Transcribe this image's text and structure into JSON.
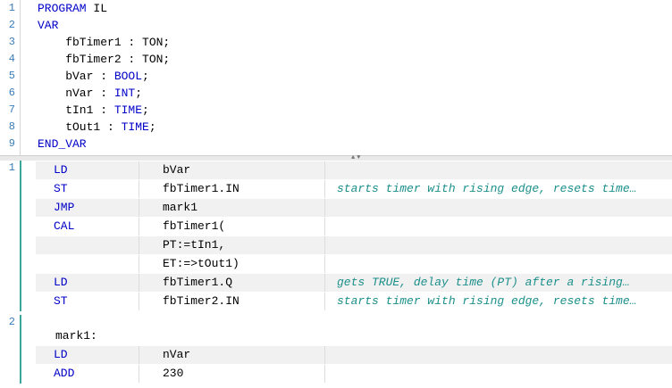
{
  "declaration": {
    "lines": [
      {
        "num": "1",
        "parts": [
          {
            "t": "PROGRAM",
            "k": "kw"
          },
          {
            "t": " IL",
            "k": ""
          }
        ]
      },
      {
        "num": "2",
        "parts": [
          {
            "t": "VAR",
            "k": "kw"
          }
        ]
      },
      {
        "num": "3",
        "parts": [
          {
            "t": "    fbTimer1 : TON;",
            "k": ""
          }
        ]
      },
      {
        "num": "4",
        "parts": [
          {
            "t": "    fbTimer2 : TON;",
            "k": ""
          }
        ]
      },
      {
        "num": "5",
        "parts": [
          {
            "t": "    bVar : ",
            "k": ""
          },
          {
            "t": "BOOL",
            "k": "type"
          },
          {
            "t": ";",
            "k": ""
          }
        ]
      },
      {
        "num": "6",
        "parts": [
          {
            "t": "    nVar : ",
            "k": ""
          },
          {
            "t": "INT",
            "k": "type"
          },
          {
            "t": ";",
            "k": ""
          }
        ]
      },
      {
        "num": "7",
        "parts": [
          {
            "t": "    tIn1 : ",
            "k": ""
          },
          {
            "t": "TIME",
            "k": "type"
          },
          {
            "t": ";",
            "k": ""
          }
        ]
      },
      {
        "num": "8",
        "parts": [
          {
            "t": "    tOut1 : ",
            "k": ""
          },
          {
            "t": "TIME",
            "k": "type"
          },
          {
            "t": ";",
            "k": ""
          }
        ]
      },
      {
        "num": "9",
        "parts": [
          {
            "t": "END_VAR",
            "k": "kw"
          }
        ]
      }
    ]
  },
  "networks": [
    {
      "number": "1",
      "label": "",
      "rows": [
        {
          "op": "LD",
          "arg": "bVar",
          "comment": "",
          "shade": true
        },
        {
          "op": "ST",
          "arg": "fbTimer1.IN",
          "comment": "starts timer with rising edge, resets time…",
          "shade": false
        },
        {
          "op": "JMP",
          "arg": "mark1",
          "comment": "",
          "shade": true
        },
        {
          "op": "CAL",
          "arg": "fbTimer1(",
          "comment": "",
          "shade": false
        },
        {
          "op": "",
          "arg": "PT:=tIn1,",
          "comment": "",
          "shade": true
        },
        {
          "op": "",
          "arg": "ET:=>tOut1)",
          "comment": "",
          "shade": false
        },
        {
          "op": "LD",
          "arg": "fbTimer1.Q",
          "comment": "gets TRUE, delay time (PT) after a rising…",
          "shade": true
        },
        {
          "op": "ST",
          "arg": "fbTimer2.IN",
          "comment": "starts timer with rising edge, resets time…",
          "shade": false
        }
      ]
    },
    {
      "number": "2",
      "label": "mark1:",
      "rows": [
        {
          "op": "LD",
          "arg": "nVar",
          "comment": "",
          "shade": true
        },
        {
          "op": "ADD",
          "arg": "230",
          "comment": "",
          "shade": false
        }
      ]
    }
  ],
  "colors": {
    "keyword": "#0000c8",
    "comment": "#1b8f8a",
    "line_number": "#3a7cb8",
    "network_bar": "#3aa79a"
  }
}
